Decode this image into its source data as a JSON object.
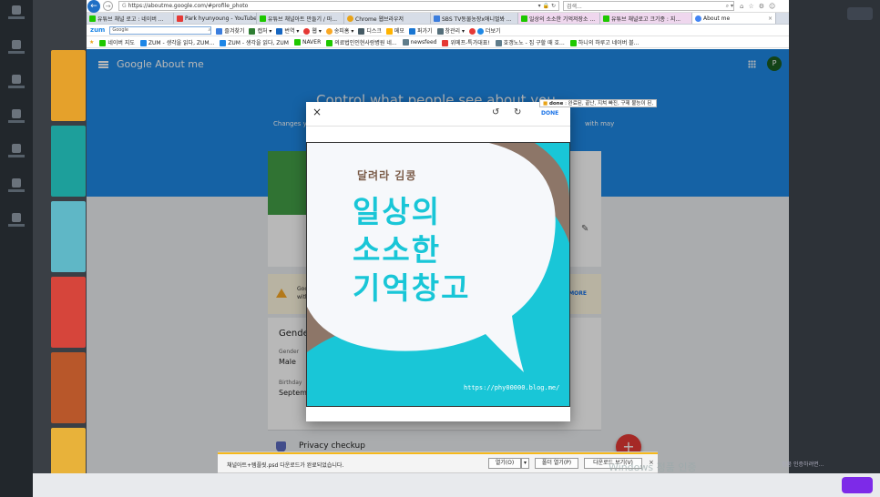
{
  "browser": {
    "url": "https://aboutme.google.com/#profile_photo",
    "search_placeholder": "검색...",
    "tabs": [
      {
        "label": "유튜브 채널 로고 : 네이버 ...",
        "color": "#1ec800"
      },
      {
        "label": "Park hyunyoung - YouTube",
        "color": "#e53935"
      },
      {
        "label": "유튜브 채널아트 만들기 / 마...",
        "color": "#1ec800"
      },
      {
        "label": "Chrome 웹브라우저",
        "color": "#e8a317"
      },
      {
        "label": "SBS TV동물농장x애니멀봐 ...",
        "color": "#3b7ddd"
      },
      {
        "label": "일상의 소소한 기억저장소 ...",
        "color": "#1ec800"
      },
      {
        "label": "유튜브 채널로고 크기종 : 지...",
        "color": "#1ec800"
      },
      {
        "label": "About me",
        "color": "#4285f4"
      }
    ],
    "toolbar": [
      "zum",
      "Google",
      "즐겨찾기",
      "캡처",
      "번역",
      "웹",
      "송피홈",
      "디스크",
      "메모",
      "퍼가기",
      "창관리",
      "더보기"
    ],
    "favorites": [
      "네이버 지도",
      "ZUM - 생각을 읽다, ZUM...",
      "ZUM - 생각을 읽다, ZUM",
      "NAVER",
      "의료법인인현사랑병원 네...",
      "newsfeed",
      "위메프-특가대표!",
      "호갱노노 - 집 구할 때 호...",
      "하니의 하루고 네이버 블..."
    ]
  },
  "google": {
    "product_title": "Google About me",
    "avatar_letter": "P",
    "control_title": "Control what people see about you",
    "control_sub_left": "Changes y",
    "control_sub_right": "with may",
    "warning_line1": "Goo",
    "warning_line2": "with",
    "warning_more": "MORE",
    "gender_title": "Gender",
    "gender_label": "Gender",
    "gender_value": "Male",
    "birthday_label": "Birthday",
    "birthday_value": "September",
    "privacy_label": "Privacy checkup",
    "fab_label": "+"
  },
  "dialog": {
    "close_glyph": "×",
    "rotate_left_glyph": "↺",
    "rotate_right_glyph": "↻",
    "done_label": "DONE",
    "tooltip_word": "done",
    "tooltip_text": " : 완료된, 끝난, 지쳐 빠진, 구제 불능이 된,",
    "image_subtitle": "달려라 김콩",
    "image_line1": "일상의",
    "image_line2": "소소한",
    "image_line3": "기억창고",
    "image_url": "https://phy00000.blog.me/"
  },
  "download": {
    "message": "채널아트+템플릿.psd 다운로드가 완료되었습니다.",
    "open_label": "열기(O)",
    "open_folder_label": "폴더 열기(P)",
    "view_downloads_label": "다운로드 보기(V)"
  },
  "background": {
    "windows_watermark": "Windows 정품 인증",
    "windows_watermark_small": "정품 인증하려면..."
  },
  "colors": {
    "blue_band": "#1e88e5",
    "cyan": "#19c6d7",
    "accent_link": "#1a73e8"
  }
}
